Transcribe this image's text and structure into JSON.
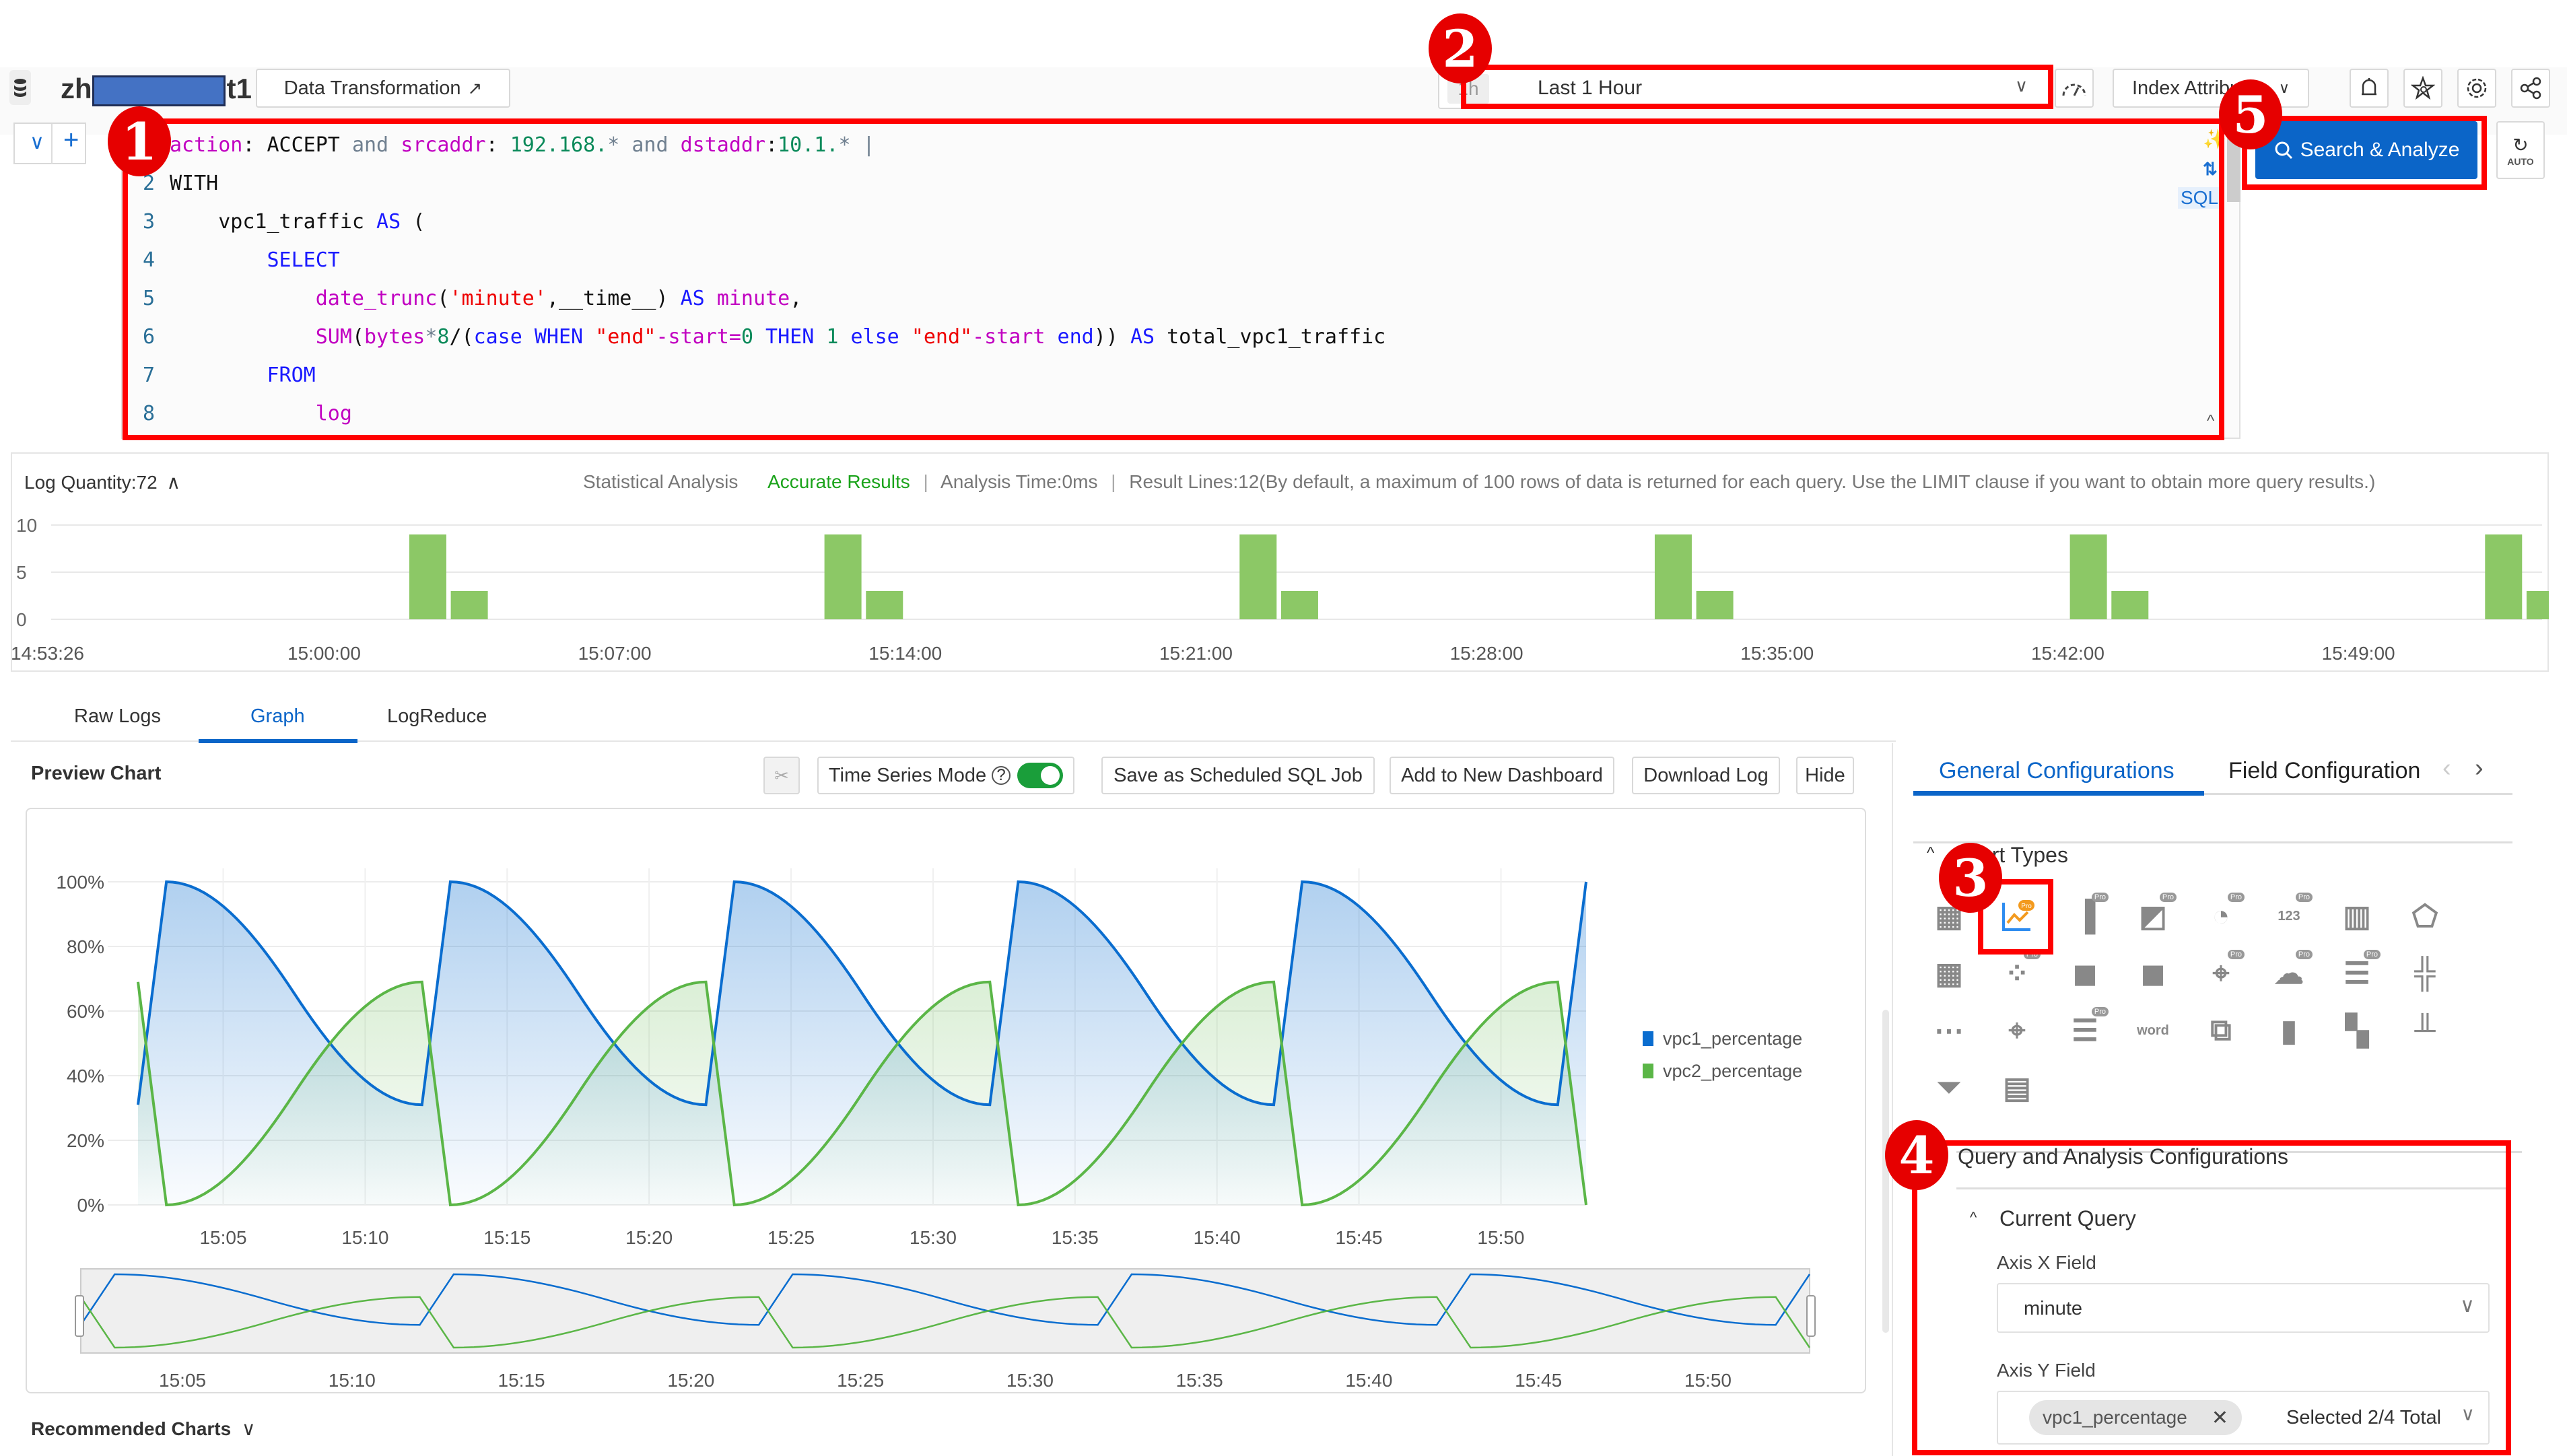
{
  "header": {
    "logstore_name_prefix": "zh",
    "logstore_name_suffix": "t1",
    "data_transformation_label": "Data Transformation",
    "time_range": {
      "prefix": "1h",
      "value": "Last 1 Hour"
    },
    "index_attributes_label": "Index Attributes",
    "search_button_label": "Search & Analyze",
    "auto_label": "AUTO"
  },
  "editor": {
    "sql_tag": "SQL",
    "lines": [
      {
        "n": "1",
        "tokens": [
          {
            "t": "action",
            "c": "fn"
          },
          {
            "t": ": ACCEPT ",
            "c": "pl"
          },
          {
            "t": "and",
            "c": "gr"
          },
          {
            "t": " ",
            "c": "pl"
          },
          {
            "t": "srcaddr",
            "c": "fn"
          },
          {
            "t": ": ",
            "c": "pl"
          },
          {
            "t": "192.168.",
            "c": "num"
          },
          {
            "t": "* ",
            "c": "gr"
          },
          {
            "t": "and",
            "c": "gr"
          },
          {
            "t": " ",
            "c": "pl"
          },
          {
            "t": "dstaddr",
            "c": "fn"
          },
          {
            "t": ":",
            "c": "pl"
          },
          {
            "t": "10.1.",
            "c": "num"
          },
          {
            "t": "* |",
            "c": "gr"
          }
        ]
      },
      {
        "n": "2",
        "tokens": [
          {
            "t": "WITH",
            "c": "pl"
          }
        ]
      },
      {
        "n": "3",
        "tokens": [
          {
            "t": "    vpc1_traffic ",
            "c": "pl"
          },
          {
            "t": "AS",
            "c": "kw"
          },
          {
            "t": " (",
            "c": "pl"
          }
        ]
      },
      {
        "n": "4",
        "tokens": [
          {
            "t": "        ",
            "c": "pl"
          },
          {
            "t": "SELECT",
            "c": "kw"
          }
        ]
      },
      {
        "n": "5",
        "tokens": [
          {
            "t": "            ",
            "c": "pl"
          },
          {
            "t": "date_trunc",
            "c": "fn"
          },
          {
            "t": "(",
            "c": "pl"
          },
          {
            "t": "'minute'",
            "c": "str"
          },
          {
            "t": ",__time__) ",
            "c": "pl"
          },
          {
            "t": "AS",
            "c": "kw"
          },
          {
            "t": " ",
            "c": "pl"
          },
          {
            "t": "minute",
            "c": "fn"
          },
          {
            "t": ",",
            "c": "pl"
          }
        ]
      },
      {
        "n": "6",
        "tokens": [
          {
            "t": "            ",
            "c": "pl"
          },
          {
            "t": "SUM",
            "c": "fn"
          },
          {
            "t": "(",
            "c": "pl"
          },
          {
            "t": "bytes",
            "c": "fn"
          },
          {
            "t": "*",
            "c": "gr"
          },
          {
            "t": "8",
            "c": "num"
          },
          {
            "t": "/(",
            "c": "pl"
          },
          {
            "t": "case WHEN ",
            "c": "kw"
          },
          {
            "t": "\"end\"",
            "c": "str"
          },
          {
            "t": "-start=",
            "c": "fn"
          },
          {
            "t": "0",
            "c": "num"
          },
          {
            "t": " THEN ",
            "c": "kw"
          },
          {
            "t": "1",
            "c": "num"
          },
          {
            "t": " else ",
            "c": "kw"
          },
          {
            "t": "\"end\"",
            "c": "str"
          },
          {
            "t": "-start",
            "c": "fn"
          },
          {
            "t": " end",
            "c": "kw"
          },
          {
            "t": ")) ",
            "c": "pl"
          },
          {
            "t": "AS",
            "c": "kw"
          },
          {
            "t": " total_vpc1_traffic",
            "c": "pl"
          }
        ]
      },
      {
        "n": "7",
        "tokens": [
          {
            "t": "        ",
            "c": "pl"
          },
          {
            "t": "FROM",
            "c": "kw"
          }
        ]
      },
      {
        "n": "8",
        "tokens": [
          {
            "t": "            ",
            "c": "pl"
          },
          {
            "t": "log",
            "c": "fn"
          }
        ]
      }
    ]
  },
  "histogram": {
    "log_quantity_label": "Log Quantity:72",
    "statistical_analysis": "Statistical Analysis",
    "accurate_results": "Accurate Results",
    "analysis_time": "Analysis Time:0ms",
    "result_lines": "Result Lines:12(By default, a maximum of 100 rows of data is returned for each query. Use the LIMIT clause if you want to obtain more query results.)",
    "y_ticks": [
      "10",
      "5",
      "0"
    ],
    "x_ticks": [
      "14:53:26",
      "15:00:00",
      "15:07:00",
      "15:14:00",
      "15:21:00",
      "15:28:00",
      "15:35:00",
      "15:42:00",
      "15:49:00"
    ],
    "bar_color": "#8cc866"
  },
  "tabs": [
    {
      "label": "Raw Logs",
      "active": false
    },
    {
      "label": "Graph",
      "active": true
    },
    {
      "label": "LogReduce",
      "active": false
    }
  ],
  "preview": {
    "title": "Preview Chart",
    "time_series_mode_label": "Time Series Mode",
    "time_series_mode_on": true,
    "save_scheduled_label": "Save as Scheduled SQL Job",
    "add_dashboard_label": "Add to New Dashboard",
    "download_log_label": "Download Log",
    "hide_label": "Hide",
    "recommended_charts_label": "Recommended Charts"
  },
  "chart_data": [
    {
      "type": "bar",
      "title": "Log Quantity",
      "xlabel": "",
      "ylabel": "",
      "ylim": [
        0,
        10
      ],
      "categories": [
        "15:03",
        "15:04",
        "15:13",
        "15:14",
        "15:23",
        "15:24",
        "15:33",
        "15:34",
        "15:43",
        "15:44",
        "15:53",
        "15:54"
      ],
      "values": [
        9,
        3,
        9,
        3,
        9,
        3,
        9,
        3,
        9,
        3,
        9,
        3
      ],
      "y_ticks": [
        0,
        5,
        10
      ],
      "x_ticks": [
        "14:53:26",
        "15:00:00",
        "15:07:00",
        "15:14:00",
        "15:21:00",
        "15:28:00",
        "15:35:00",
        "15:42:00",
        "15:49:00"
      ],
      "grid": true
    },
    {
      "type": "area",
      "title": "",
      "xlabel": "",
      "ylabel": "",
      "ylim": [
        0,
        100
      ],
      "y_ticks": [
        "0%",
        "20%",
        "40%",
        "60%",
        "80%",
        "100%"
      ],
      "x_ticks": [
        "15:05",
        "15:10",
        "15:15",
        "15:20",
        "15:25",
        "15:30",
        "15:35",
        "15:40",
        "15:45",
        "15:50"
      ],
      "x": [
        "15:02",
        "15:03",
        "15:12",
        "15:13",
        "15:22",
        "15:23",
        "15:32",
        "15:33",
        "15:42",
        "15:43",
        "15:52",
        "15:53"
      ],
      "x_minutes": [
        2,
        3,
        12,
        13,
        22,
        23,
        32,
        33,
        42,
        43,
        52,
        53
      ],
      "x_range_minutes": [
        2,
        53
      ],
      "curve": "smooth between peaks",
      "series": [
        {
          "name": "vpc1_percentage",
          "color": "#0a6dcf",
          "values": [
            31,
            100,
            31,
            100,
            31,
            100,
            31,
            100,
            31,
            100,
            31,
            100
          ]
        },
        {
          "name": "vpc2_percentage",
          "color": "#5bb647",
          "values": [
            69,
            0,
            69,
            0,
            69,
            0,
            69,
            0,
            69,
            0,
            69,
            0
          ]
        }
      ],
      "legend": "right",
      "grid": true,
      "overview_slider_ticks": [
        "15:05",
        "15:10",
        "15:15",
        "15:20",
        "15:25",
        "15:30",
        "15:35",
        "15:40",
        "15:45",
        "15:50"
      ]
    }
  ],
  "config_panel": {
    "tabs": [
      "General Configurations",
      "Field Configuration"
    ],
    "chart_types_title": "Chart Types",
    "chart_types": [
      [
        "table-pro",
        "line-pro",
        "bar-pro",
        "area-pro",
        "pie-pro",
        "single-value-pro",
        "histogram",
        "radar"
      ],
      [
        "table",
        "scatter-pro",
        "china-map",
        "world-map",
        "map-pro",
        "amap-pro",
        "flow-pro",
        "candlestick"
      ],
      [
        "sankey-timeline",
        "location-map",
        "bar-list-pro",
        "word-cloud",
        "topology",
        "column",
        "treemap",
        "histogram-bar"
      ],
      [
        "funnel",
        "cross-table"
      ]
    ],
    "selected_chart_type": "line-pro",
    "query_config_title": "Query and Analysis Configurations",
    "current_query_label": "Current Query",
    "axis_x_label": "Axis X Field",
    "axis_x_value": "minute",
    "axis_y_label": "Axis Y Field",
    "axis_y_tag": "vpc1_percentage",
    "axis_y_summary": "Selected 2/4 Total"
  },
  "annotations": [
    "1",
    "2",
    "3",
    "4",
    "5"
  ]
}
